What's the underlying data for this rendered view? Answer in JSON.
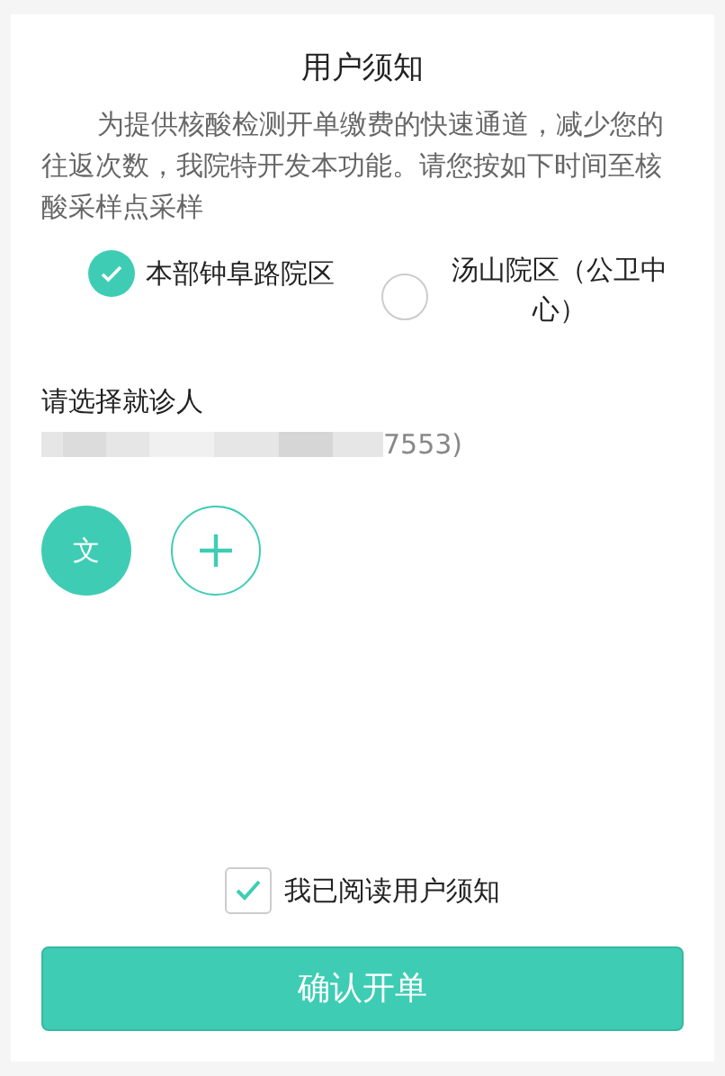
{
  "title": "用户须知",
  "notice": "为提供核酸检测开单缴费的快速通道，减少您的往返次数，我院特开发本功能。请您按如下时间至核酸采样点采样",
  "campuses": [
    {
      "label": "本部钟阜路院区",
      "selected": true
    },
    {
      "label": "汤山院区（公卫中心）",
      "selected": false
    }
  ],
  "patient_section": {
    "label": "请选择就诊人",
    "patient_info": "7553)",
    "patients": [
      {
        "initial": "文",
        "selected": true
      }
    ]
  },
  "agree": {
    "label": "我已阅读用户须知",
    "checked": true
  },
  "submit": "确认开单"
}
